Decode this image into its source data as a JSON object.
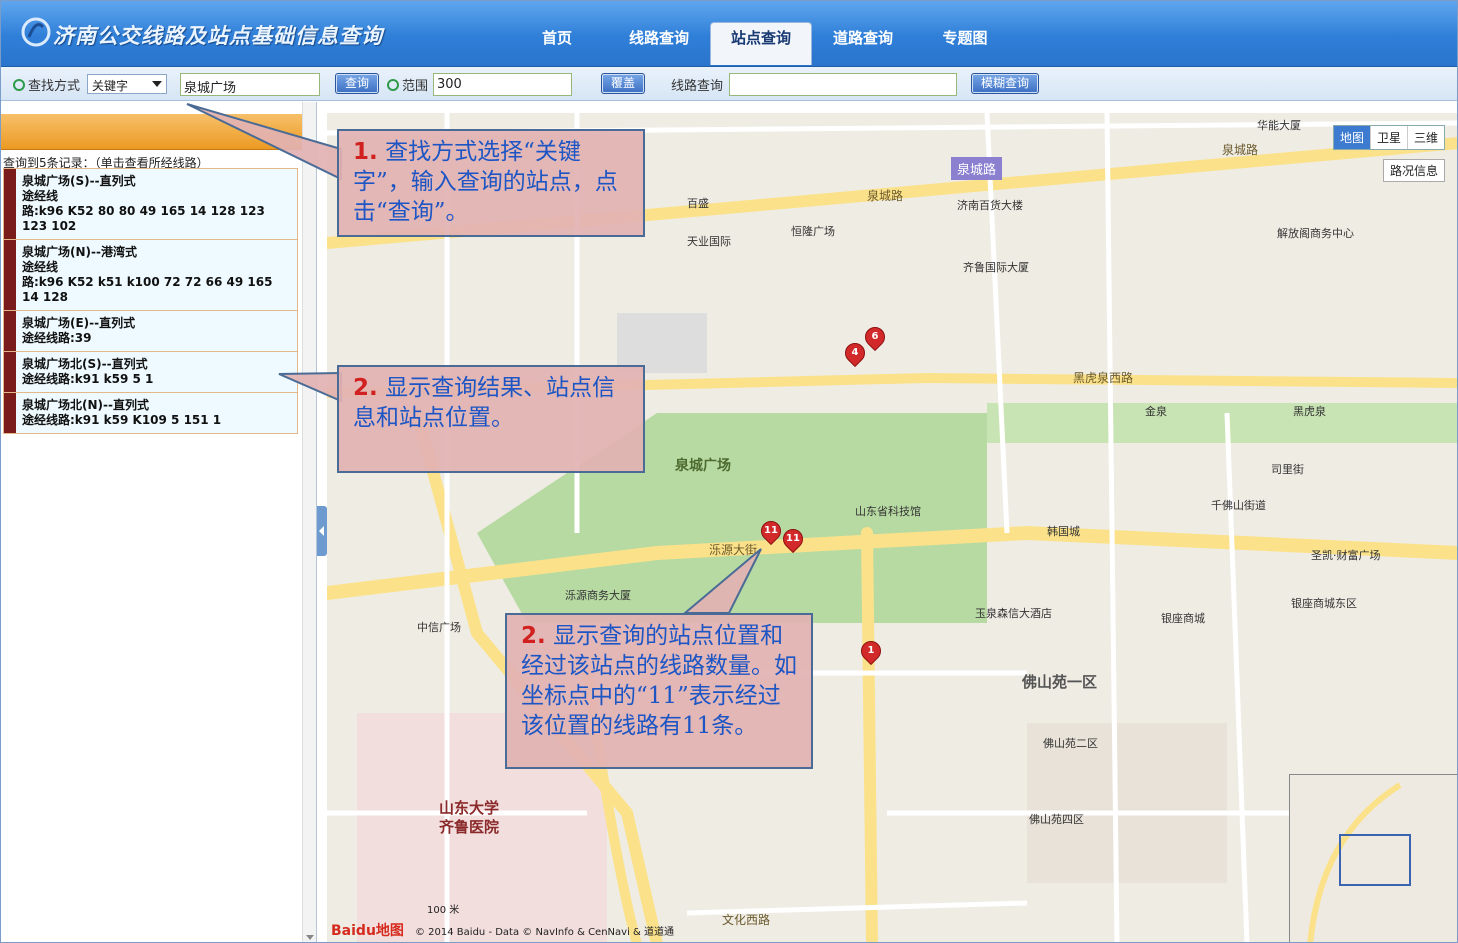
{
  "header": {
    "title": "济南公交线路及站点基础信息查询",
    "tabs": [
      "首页",
      "线路查询",
      "站点查询",
      "道路查询",
      "专题图"
    ],
    "active_tab": "站点查询"
  },
  "toolbar": {
    "search_mode_label": "查找方式",
    "search_mode_value": "关键字",
    "keyword_value": "泉城广场",
    "query_button": "查询",
    "range_label": "范围",
    "range_value": "300",
    "cover_button": "覆盖",
    "route_query_label": "线路查询",
    "route_query_value": "",
    "fuzzy_button": "模糊查询"
  },
  "results": {
    "summary": "查询到5条记录：（单击查看所经线路）",
    "records": [
      {
        "name": "泉城广场(S)--直列式",
        "l2": "途经线",
        "l3": "路:k96 K52 80 80 49 165 14 128 123 123 102"
      },
      {
        "name": "泉城广场(N)--港湾式",
        "l2": "途经线",
        "l3": "路:k96 K52 k51 k100 72 72 66 49 165 14 128"
      },
      {
        "name": "泉城广场(E)--直列式",
        "l2": "途经线路:39",
        "l3": ""
      },
      {
        "name": "泉城广场北(S)--直列式",
        "l2": "途经线路:k91 k59 5 1",
        "l3": ""
      },
      {
        "name": "泉城广场北(N)--直列式",
        "l2": "途经线路:k91 k59 K109 5 151 1",
        "l3": ""
      }
    ]
  },
  "map": {
    "types": [
      "地图",
      "卫星",
      "三维"
    ],
    "traffic": "路况信息",
    "copyright": "© 2014 Baidu - Data © NavInfo & CenNavi & 道道通",
    "logo": "Baidu地图",
    "scale": "100 米",
    "labels": {
      "park": "泉城广场",
      "quancheng_road": "泉城路",
      "luoyuan": "泺源大街",
      "heihu": "黑虎泉西路",
      "foshan": "佛山苑一区",
      "hospital": "山东大学\n齐鲁医院",
      "wenhua": "文化西路",
      "quancheng_road_badge": "泉城路",
      "baisheng": "百盛",
      "tianye": "天业国际",
      "hengchang": "恒隆广场",
      "jinan_baihuo": "济南百货大楼",
      "qilu_gj": "齐鲁国际大厦",
      "keji": "山东省科技馆",
      "yinzuo": "银座商城",
      "hanguocheng": "韩国城",
      "jinquan": "金泉",
      "wanxiang": "泺源商务大厦",
      "heihuquan": "黑虎泉",
      "qian": "千佛山街道",
      "sima": "司里街",
      "zhongxin": "中信广场",
      "shengcai": "圣凯·财富广场",
      "yinzuo_east": "银座商城东区",
      "foshan2": "佛山苑二区",
      "foshan4": "佛山苑四区",
      "yuquan": "玉泉森信大酒店",
      "huaneng": "华能大厦",
      "jiefang": "解放阁商务中心",
      "chaoshan": "泉城路"
    },
    "pins": [
      {
        "label": "6"
      },
      {
        "label": "4"
      },
      {
        "label": "11"
      },
      {
        "label": "11"
      },
      {
        "label": "1"
      }
    ]
  },
  "callouts": {
    "c1": {
      "num": "1.",
      "text": "查找方式选择“关键字”，输入查询的站点，点击“查询”。"
    },
    "c2": {
      "num": "2.",
      "text": "显示查询结果、站点信息和站点位置。"
    },
    "c3": {
      "num": "2.",
      "text": "显示查询的站点位置和经过该站点的线路数量。如坐标点中的“11”表示经过该位置的线路有11条。"
    }
  },
  "colors": {
    "header": "#2f7fd8",
    "accent_orange": "#eb9a22",
    "callout_bg": "#e2b2b2",
    "pin": "#d22a2a"
  }
}
